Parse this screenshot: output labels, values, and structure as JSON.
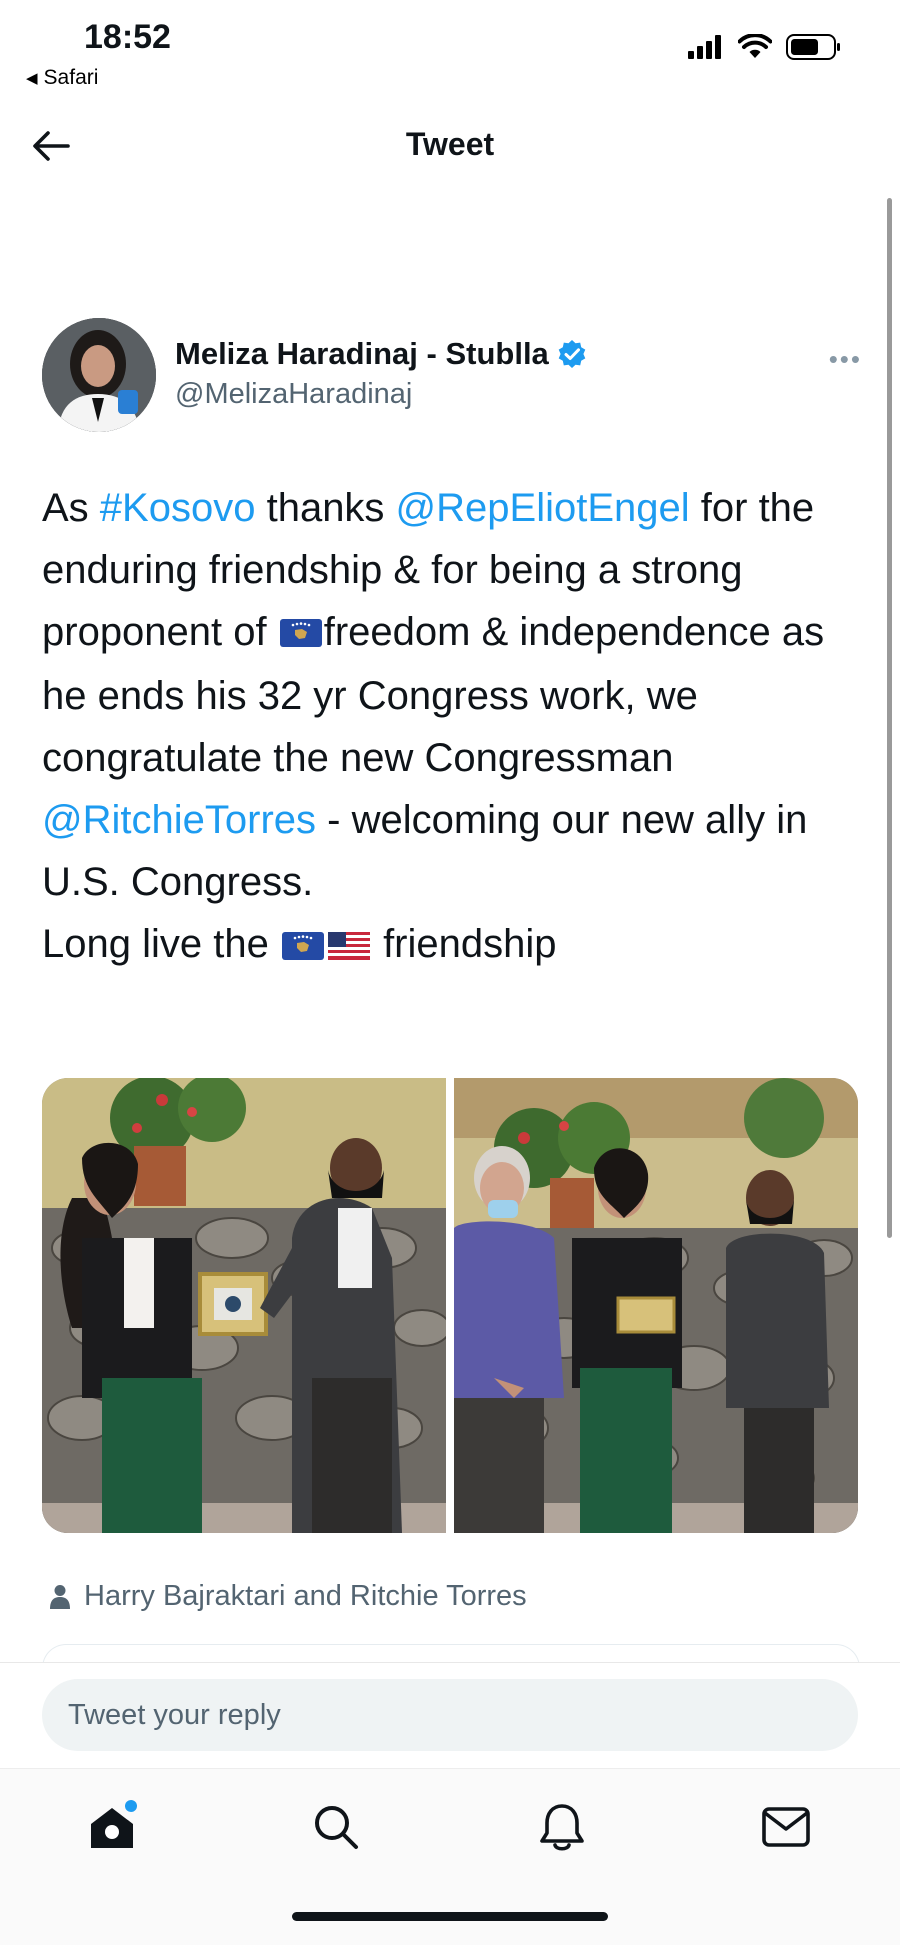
{
  "status_bar": {
    "time": "18:52",
    "back_app": "Safari"
  },
  "nav": {
    "title": "Tweet"
  },
  "author": {
    "name": "Meliza Haradinaj - Stublla",
    "handle": "@MelizaHaradinaj"
  },
  "tweet": {
    "t1": "As ",
    "hashtag_kosovo": "#Kosovo",
    "t2": " thanks ",
    "mention_engel": "@RepEliotEngel",
    "t3": " for the enduring friendship & for being a strong proponent of ",
    "t4": "freedom & independence as he ends his 32 yr Congress work, we congratulate the new Congressman ",
    "mention_torres": "@RitchieTorres",
    "t5": " - welcoming our new ally in U.S. Congress.",
    "t6": "Long live the ",
    "t7": " friendship"
  },
  "tagged": {
    "text": "Harry Bajraktari and Ritchie Torres"
  },
  "reply": {
    "placeholder": "Tweet your reply"
  },
  "colors": {
    "link": "#1d9bf0",
    "verified": "#1d9bf0",
    "text": "#0f1419",
    "muted": "#536471"
  }
}
